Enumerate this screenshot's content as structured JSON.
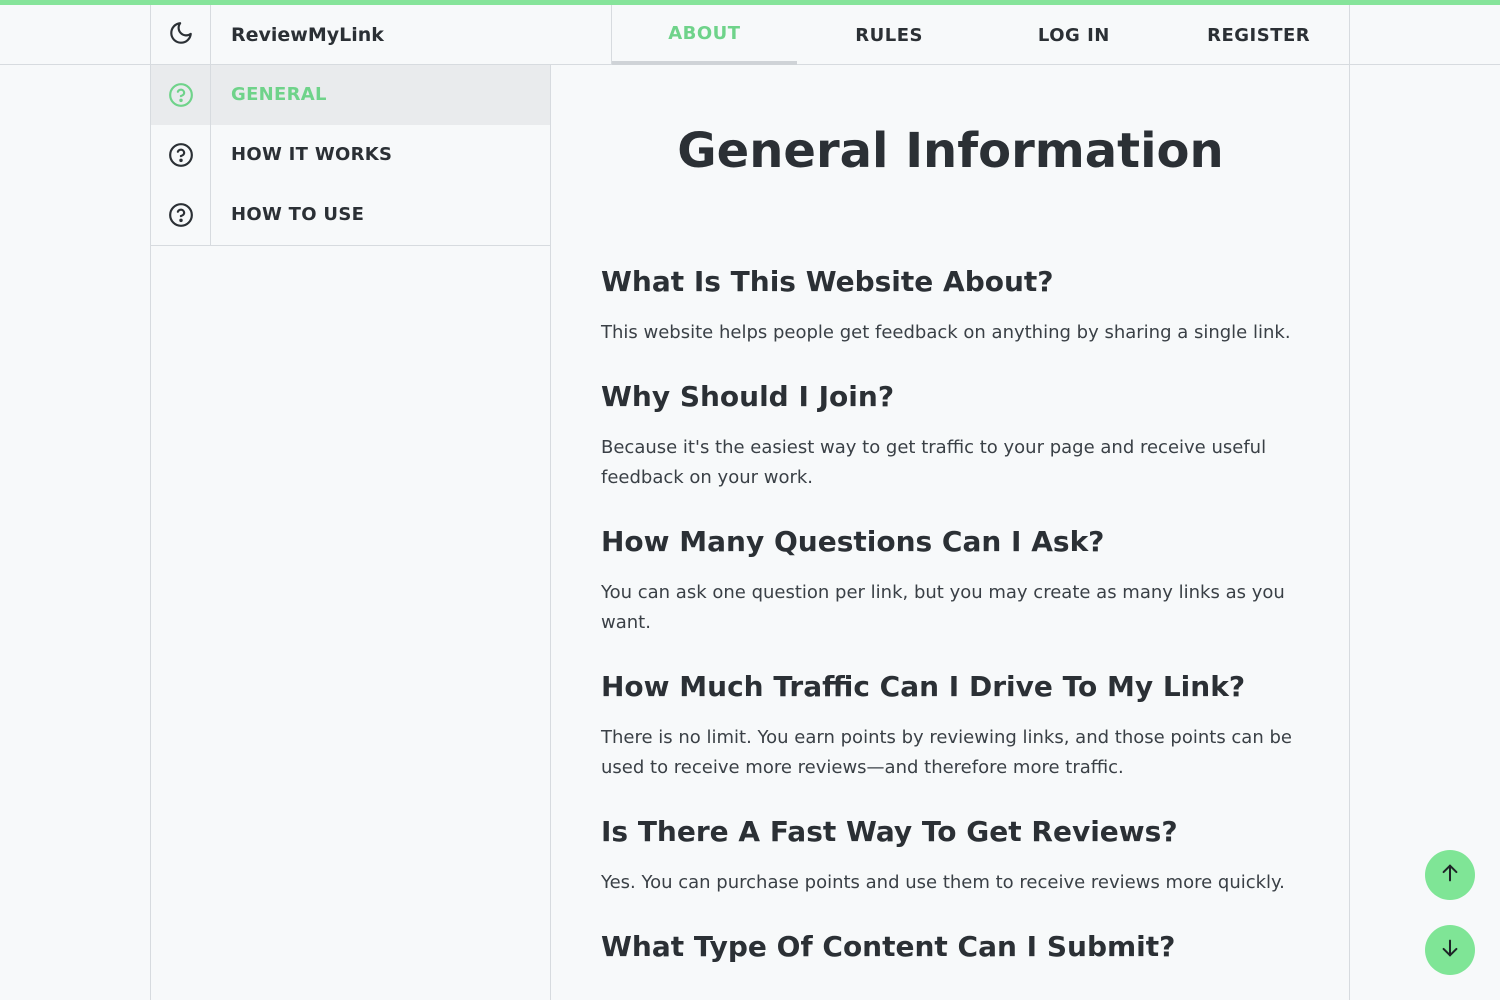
{
  "brand": {
    "name": "ReviewMyLink"
  },
  "nav": {
    "tabs": [
      {
        "label": "ABOUT",
        "active": true
      },
      {
        "label": "RULES"
      },
      {
        "label": "LOG IN"
      },
      {
        "label": "REGISTER"
      }
    ]
  },
  "sidebar": {
    "items": [
      {
        "label": "GENERAL",
        "active": true,
        "icon": "question-circle-icon"
      },
      {
        "label": "HOW IT WORKS",
        "icon": "question-circle-icon"
      },
      {
        "label": "HOW TO USE",
        "icon": "question-circle-icon"
      }
    ]
  },
  "main": {
    "title": "General Information",
    "faq": [
      {
        "question": "What Is This Website About?",
        "answer": "This website helps people get feedback on anything by sharing a single link."
      },
      {
        "question": "Why Should I Join?",
        "answer": "Because it's the easiest way to get traffic to your page and receive useful feedback on your work."
      },
      {
        "question": "How Many Questions Can I Ask?",
        "answer": "You can ask one question per link, but you may create as many links as you want."
      },
      {
        "question": "How Much Traffic Can I Drive To My Link?",
        "answer": "There is no limit. You earn points by reviewing links, and those points can be used to receive more reviews—and therefore more traffic."
      },
      {
        "question": "Is There A Fast Way To Get Reviews?",
        "answer": "Yes. You can purchase points and use them to receive reviews more quickly."
      },
      {
        "question": "What Type Of Content Can I Submit?",
        "answer": ""
      }
    ]
  },
  "colors": {
    "accent": "#7fe596",
    "active_text": "#6fd38a",
    "text": "#2b3035"
  }
}
